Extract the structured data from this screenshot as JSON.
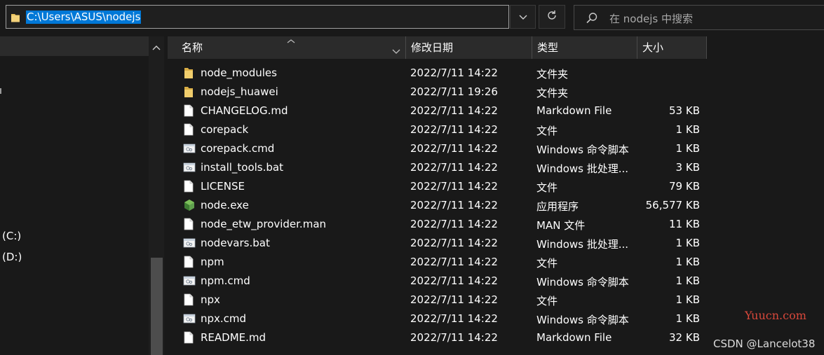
{
  "address_bar": {
    "path": "C:\\Users\\ASUS\\nodejs"
  },
  "search": {
    "placeholder": "在 nodejs 中搜索"
  },
  "nav": {
    "items": [
      "(C:)",
      "(D:)"
    ]
  },
  "columns": {
    "name": "名称",
    "date": "修改日期",
    "type": "类型",
    "size": "大小"
  },
  "files": [
    {
      "icon": "folder-icon",
      "name": "node_modules",
      "date": "2022/7/11 14:22",
      "type": "文件夹",
      "size": ""
    },
    {
      "icon": "folder-icon",
      "name": "nodejs_huawei",
      "date": "2022/7/11 19:26",
      "type": "文件夹",
      "size": ""
    },
    {
      "icon": "file-icon",
      "name": "CHANGELOG.md",
      "date": "2022/7/11 14:22",
      "type": "Markdown File",
      "size": "53 KB"
    },
    {
      "icon": "file-icon",
      "name": "corepack",
      "date": "2022/7/11 14:22",
      "type": "文件",
      "size": "1 KB"
    },
    {
      "icon": "script-icon",
      "name": "corepack.cmd",
      "date": "2022/7/11 14:22",
      "type": "Windows 命令脚本",
      "size": "1 KB"
    },
    {
      "icon": "script-icon",
      "name": "install_tools.bat",
      "date": "2022/7/11 14:22",
      "type": "Windows 批处理...",
      "size": "3 KB"
    },
    {
      "icon": "file-icon",
      "name": "LICENSE",
      "date": "2022/7/11 14:22",
      "type": "文件",
      "size": "79 KB"
    },
    {
      "icon": "node-exe-icon",
      "name": "node.exe",
      "date": "2022/7/11 14:22",
      "type": "应用程序",
      "size": "56,577 KB"
    },
    {
      "icon": "file-icon",
      "name": "node_etw_provider.man",
      "date": "2022/7/11 14:22",
      "type": "MAN 文件",
      "size": "11 KB"
    },
    {
      "icon": "script-icon",
      "name": "nodevars.bat",
      "date": "2022/7/11 14:22",
      "type": "Windows 批处理...",
      "size": "1 KB"
    },
    {
      "icon": "file-icon",
      "name": "npm",
      "date": "2022/7/11 14:22",
      "type": "文件",
      "size": "1 KB"
    },
    {
      "icon": "script-icon",
      "name": "npm.cmd",
      "date": "2022/7/11 14:22",
      "type": "Windows 命令脚本",
      "size": "1 KB"
    },
    {
      "icon": "file-icon",
      "name": "npx",
      "date": "2022/7/11 14:22",
      "type": "文件",
      "size": "1 KB"
    },
    {
      "icon": "script-icon",
      "name": "npx.cmd",
      "date": "2022/7/11 14:22",
      "type": "Windows 命令脚本",
      "size": "1 KB"
    },
    {
      "icon": "file-icon",
      "name": "README.md",
      "date": "2022/7/11 14:22",
      "type": "Markdown File",
      "size": "32 KB"
    }
  ],
  "watermarks": {
    "site": "Yuucn.com",
    "author": "CSDN @Lancelot38"
  },
  "colors": {
    "selection": "#0078d7",
    "background": "#191919",
    "header": "#2b2b2b",
    "folder": "#e8c15a",
    "node": "#5fa04e"
  }
}
